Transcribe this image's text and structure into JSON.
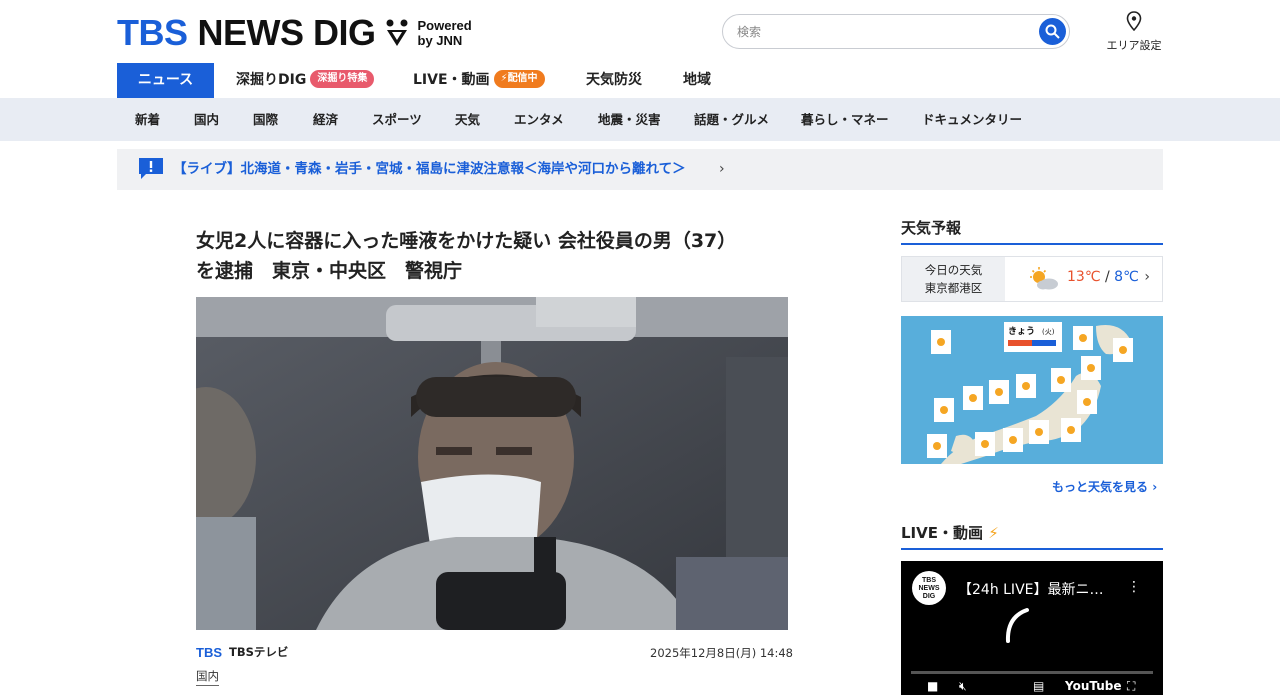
{
  "header": {
    "logo_tbs": "TBS",
    "logo_news": "NEWS DIG",
    "logo_powered_1": "Powered",
    "logo_powered_2": "by JNN",
    "search_placeholder": "検索",
    "area_label": "エリア設定"
  },
  "main_nav": {
    "news": "ニュース",
    "fukabori": "深掘りDIG",
    "fukabori_badge": "深掘り特集",
    "live": "LIVE・動画",
    "live_badge": "配信中",
    "weather": "天気防災",
    "region": "地域"
  },
  "sub_nav": [
    "新着",
    "国内",
    "国際",
    "経済",
    "スポーツ",
    "天気",
    "エンタメ",
    "地震・災害",
    "話題・グルメ",
    "暮らし・マネー",
    "ドキュメンタリー"
  ],
  "alert": {
    "text": "【ライブ】北海道・青森・岩手・宮城・福島に津波注意報＜海岸や河口から離れて＞"
  },
  "article": {
    "title_line1": "女児2人に容器に入った唾液をかけた疑い 会社役員の男（37）",
    "title_line2": "を逮捕　東京・中央区　警視庁",
    "source_logo": "TBS",
    "source_name": "TBSテレビ",
    "date": "2025年12月8日(月) 14:48",
    "category": "国内"
  },
  "sidebar": {
    "weather_title": "天気予報",
    "today_label": "今日の天気",
    "location": "東京都港区",
    "high": "13℃",
    "sep": "/",
    "low": "8℃",
    "map_heading": "きょう",
    "map_day": "(火)",
    "more_weather": "もっと天気を見る",
    "live_title": "LIVE・動画",
    "video_channel_1": "TBS",
    "video_channel_2": "NEWS",
    "video_channel_3": "DIG",
    "video_title": "【24h LIVE】最新ニ…",
    "video_platform": "YouTube"
  },
  "colors": {
    "brand_blue": "#1a5fd8",
    "badge_red": "#e85a6c",
    "badge_orange": "#f07b1e",
    "temp_high": "#e8512c"
  }
}
